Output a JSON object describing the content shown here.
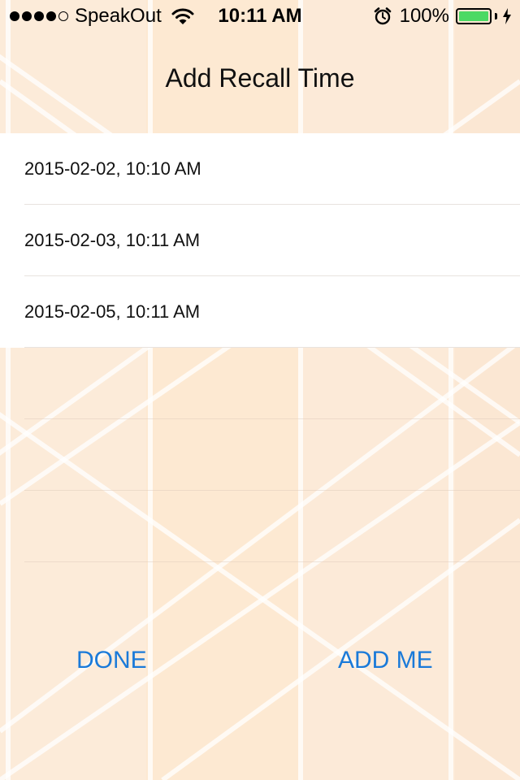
{
  "status_bar": {
    "signal_bars_filled": 4,
    "signal_bars_total": 5,
    "carrier": "SpeakOut",
    "wifi_icon": "wifi-icon",
    "time": "10:11 AM",
    "alarm_icon": "alarm-clock-icon",
    "battery_percent_text": "100%",
    "battery_level": 1.0,
    "battery_color": "#4cd964",
    "charging_icon": "bolt-icon"
  },
  "nav": {
    "title": "Add Recall Time"
  },
  "recall_times": [
    "2015-02-02, 10:10 AM",
    "2015-02-03, 10:11 AM",
    "2015-02-05, 10:11 AM"
  ],
  "actions": {
    "done_label": "DONE",
    "add_label": "ADD ME"
  },
  "colors": {
    "accent": "#1a7ad9",
    "background": "#fbe9d6"
  }
}
